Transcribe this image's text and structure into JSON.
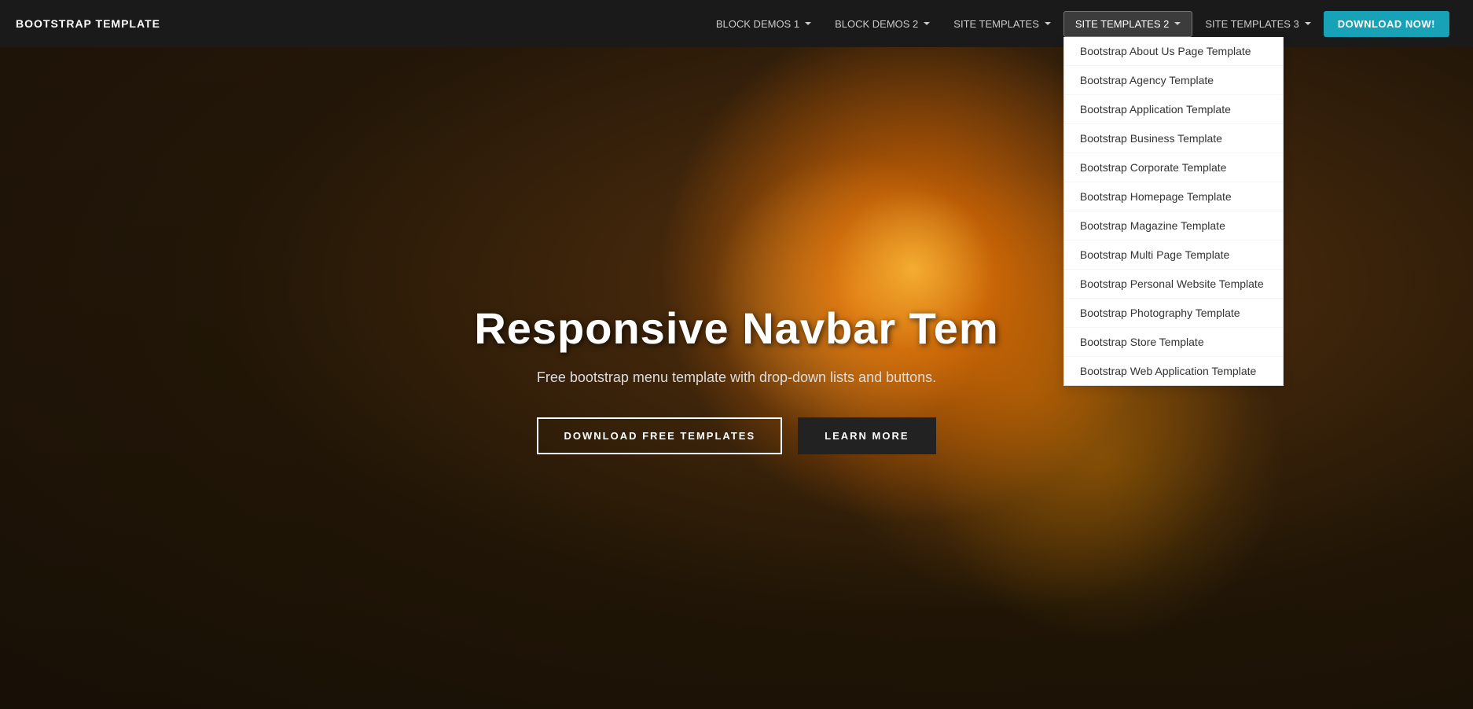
{
  "navbar": {
    "brand": "BOOTSTRAP TEMPLATE",
    "items": [
      {
        "id": "block-demos-1",
        "label": "BLOCK DEMOS 1",
        "has_dropdown": true,
        "active": false
      },
      {
        "id": "block-demos-2",
        "label": "BLOCK DEMOS 2",
        "has_dropdown": true,
        "active": false
      },
      {
        "id": "site-templates",
        "label": "SITE TEMPLATES",
        "has_dropdown": true,
        "active": false
      },
      {
        "id": "site-templates-2",
        "label": "SITE TEMPLATES 2",
        "has_dropdown": true,
        "active": true
      },
      {
        "id": "site-templates-3",
        "label": "SITE TEMPLATES 3",
        "has_dropdown": true,
        "active": false
      }
    ],
    "download_button": "DOWNLOAD NOW!"
  },
  "dropdown": {
    "title": "SITE TEMPLATES 2",
    "items": [
      "Bootstrap About Us Page Template",
      "Bootstrap Agency Template",
      "Bootstrap Application Template",
      "Bootstrap Business Template",
      "Bootstrap Corporate Template",
      "Bootstrap Homepage Template",
      "Bootstrap Magazine Template",
      "Bootstrap Multi Page Template",
      "Bootstrap Personal Website Template",
      "Bootstrap Photography Template",
      "Bootstrap Store Template",
      "Bootstrap Web Application Template"
    ]
  },
  "hero": {
    "title": "Responsive Navbar Tem",
    "subtitle": "Free bootstrap menu template with drop-down lists and buttons.",
    "btn_download": "DOWNLOAD FREE TEMPLATES",
    "btn_learn": "LEARN MORE"
  }
}
